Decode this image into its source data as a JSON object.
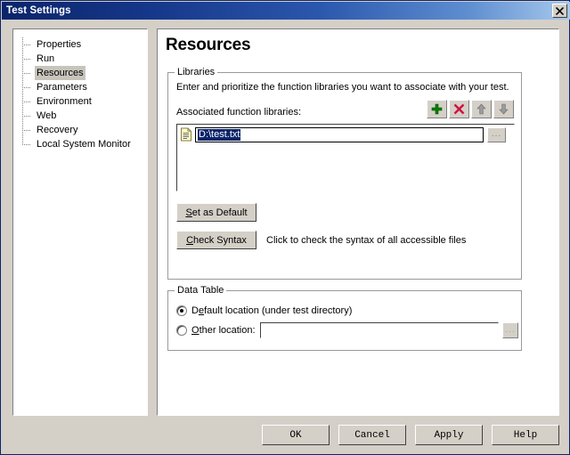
{
  "window": {
    "title": "Test Settings",
    "close_icon": "close-icon"
  },
  "tree": {
    "items": [
      {
        "label": "Properties",
        "selected": false
      },
      {
        "label": "Run",
        "selected": false
      },
      {
        "label": "Resources",
        "selected": true
      },
      {
        "label": "Parameters",
        "selected": false
      },
      {
        "label": "Environment",
        "selected": false
      },
      {
        "label": "Web",
        "selected": false
      },
      {
        "label": "Recovery",
        "selected": false
      },
      {
        "label": "Local System Monitor",
        "selected": false
      }
    ]
  },
  "page": {
    "title": "Resources"
  },
  "libraries": {
    "group_title": "Libraries",
    "description": "Enter and prioritize the function libraries you want to associate with your test.",
    "list_label": "Associated function libraries:",
    "toolbar": [
      {
        "name": "add-library-button",
        "icon": "plus-icon",
        "color": "#008000"
      },
      {
        "name": "remove-library-button",
        "icon": "x-icon",
        "color": "#d01040"
      },
      {
        "name": "move-up-button",
        "icon": "arrow-up-icon",
        "color": "#9a9a9a"
      },
      {
        "name": "move-down-button",
        "icon": "arrow-down-icon",
        "color": "#9a9a9a"
      }
    ],
    "entries": [
      {
        "value": "D:\\test.txt",
        "selected": true,
        "icon": "document-icon",
        "browse_label": "..."
      }
    ],
    "set_default_label_pre": "S",
    "set_default_label_post": "et as Default",
    "check_syntax_label_pre": "C",
    "check_syntax_label_post": "heck Syntax",
    "syntax_hint": "Click to check the syntax of all accessible files"
  },
  "data_table": {
    "group_title": "Data Table",
    "default_label_pre": "D",
    "default_label_accel": "e",
    "default_label_post": "fault location (under test directory)",
    "default_selected": true,
    "other_label_accel": "O",
    "other_label_post": "ther location:",
    "other_selected": false,
    "other_value": "",
    "other_browse_label": "..."
  },
  "footer": {
    "buttons": [
      {
        "label": "OK",
        "name": "ok-button"
      },
      {
        "label": "Cancel",
        "name": "cancel-button"
      },
      {
        "label": "Apply",
        "name": "apply-button"
      },
      {
        "label": "Help",
        "name": "help-button"
      }
    ]
  },
  "colors": {
    "title_bar_start": "#0a246a",
    "title_bar_end": "#a6c8ec",
    "dialog_face": "#d4d0c8",
    "selection": "#0a246a",
    "tree_selection": "#c8c4bc"
  }
}
